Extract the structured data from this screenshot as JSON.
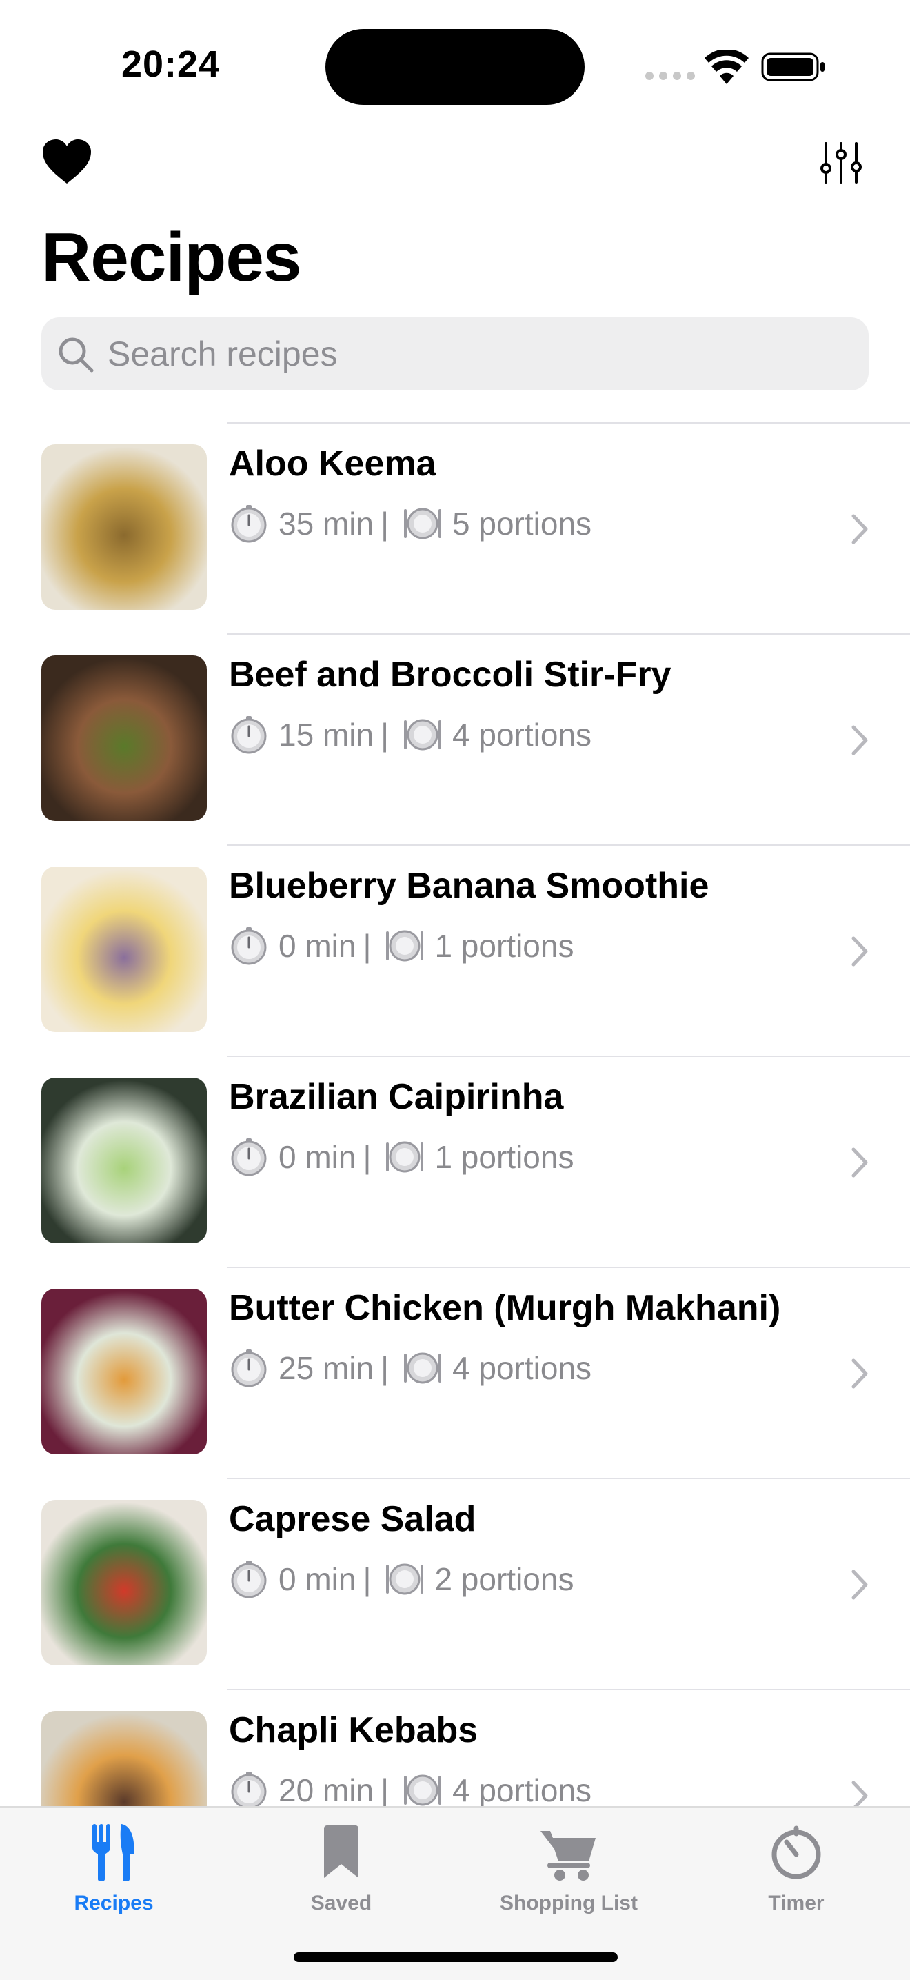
{
  "status_bar": {
    "time": "20:24"
  },
  "nav": {
    "title": "Recipes",
    "left_icon": "heart-icon",
    "right_icon": "sliders-icon"
  },
  "search": {
    "placeholder": "Search recipes",
    "value": ""
  },
  "recipes": [
    {
      "name": "Aloo Keema",
      "time": "35 min",
      "portions": "5 portions",
      "thumb_colors": [
        "#e8e2d4",
        "#8b6a2e",
        "#c9a24a"
      ]
    },
    {
      "name": "Beef and Broccoli Stir-Fry",
      "time": "15 min",
      "portions": "4 portions",
      "thumb_colors": [
        "#3b2a1e",
        "#5a7a2a",
        "#8a5a3a"
      ]
    },
    {
      "name": "Blueberry Banana Smoothie",
      "time": "0 min",
      "portions": "1 portions",
      "thumb_colors": [
        "#f1e9d8",
        "#8a6f9c",
        "#f0d67a"
      ]
    },
    {
      "name": "Brazilian Caipirinha",
      "time": "0 min",
      "portions": "1 portions",
      "thumb_colors": [
        "#2f3b2f",
        "#a8d27a",
        "#dfe8d8"
      ]
    },
    {
      "name": "Butter Chicken (Murgh Makhani)",
      "time": "25 min",
      "portions": "4 portions",
      "thumb_colors": [
        "#6a1f3a",
        "#e29a3a",
        "#dfe6d8"
      ]
    },
    {
      "name": "Caprese Salad",
      "time": "0 min",
      "portions": "2 portions",
      "thumb_colors": [
        "#e9e4dc",
        "#d23a2a",
        "#3f7a3a"
      ]
    },
    {
      "name": "Chapli Kebabs",
      "time": "20 min",
      "portions": "4 portions",
      "thumb_colors": [
        "#d8d2c4",
        "#5a3a2a",
        "#e0a04a"
      ]
    }
  ],
  "meta_separator": "|",
  "tabs": [
    {
      "label": "Recipes",
      "icon": "fork-knife-icon",
      "active": true
    },
    {
      "label": "Saved",
      "icon": "bookmark-icon",
      "active": false
    },
    {
      "label": "Shopping List",
      "icon": "cart-icon",
      "active": false
    },
    {
      "label": "Timer",
      "icon": "timer-icon",
      "active": false
    }
  ],
  "colors": {
    "accent": "#1a7cf5",
    "inactive": "#8e8e93",
    "meta_text": "#8a8a8e",
    "separator": "#e1e1e6"
  }
}
